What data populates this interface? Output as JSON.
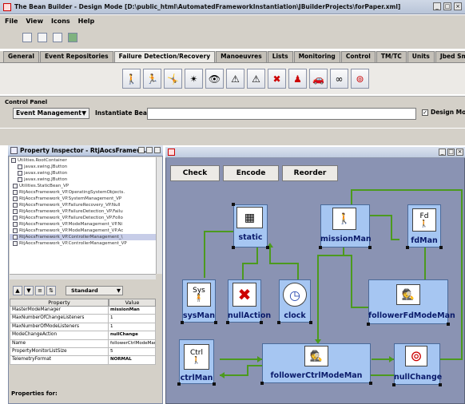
{
  "window": {
    "title": "The Bean Builder - Design Mode [D:\\public_html\\AutomatedFrameworkInstantiation\\JBuilderProjects\\forPaper.xml]"
  },
  "menu": [
    "File",
    "View",
    "Icons",
    "Help"
  ],
  "tabs": [
    {
      "label": "General",
      "active": false
    },
    {
      "label": "Event Repositories",
      "active": false
    },
    {
      "label": "Failure Detection/Recovery",
      "active": true
    },
    {
      "label": "Manoeuvres",
      "active": false
    },
    {
      "label": "Lists",
      "active": false
    },
    {
      "label": "Monitoring",
      "active": false
    },
    {
      "label": "Control",
      "active": false
    },
    {
      "label": "TM/TC",
      "active": false
    },
    {
      "label": "Units",
      "active": false
    },
    {
      "label": "Jbed Smm",
      "active": false
    }
  ],
  "palette_icons": [
    "bean-figure-icon",
    "bean-figure-run-icon",
    "bean-figure-jump-icon",
    "bean-figure-star-icon",
    "eye-icon",
    "recovery-warning-icon",
    "reset-warning-icon",
    "cross-figure-icon",
    "red-person-icon",
    "car-icon",
    "link-icon",
    "two-circles-icon"
  ],
  "control_panel": {
    "label": "Control Panel",
    "event_select": "Event Management",
    "instantiate_label": "Instantiate Bean",
    "instantiate_value": "",
    "design_mode_label": "Design Mode",
    "design_mode_checked": true
  },
  "property_inspector": {
    "title": "Property Inspector - RtjAocsFramew...",
    "tree": [
      {
        "label": "Utilities.RootContainer",
        "selected": false
      },
      {
        "label": "javax.swing.JButton",
        "selected": false
      },
      {
        "label": "javax.swing.JButton",
        "selected": false
      },
      {
        "label": "javax.swing.JButton",
        "selected": false
      },
      {
        "label": "Utilities.StaticBean_VP",
        "selected": false
      },
      {
        "label": "RtjAocsFramework_VP.OperatingSystemObjects.",
        "selected": false
      },
      {
        "label": "RtjAocsFramework_VP.SystemManagement_VP",
        "selected": false
      },
      {
        "label": "RtjAocsFramework_VP.FailureRecovery_VP.Null",
        "selected": false
      },
      {
        "label": "RtjAocsFramework_VP.FailureDetection_VP.Failu",
        "selected": false
      },
      {
        "label": "RtjAocsFramework_VP.FailureDetection_VP.Follo",
        "selected": false
      },
      {
        "label": "RtjAocsFramework_VP.ModeManagement_VP.Ni",
        "selected": false
      },
      {
        "label": "RtjAocsFramework_VP.ModeManagement_VP.Ac",
        "selected": false
      },
      {
        "label": "RtjAocsFramework_VP.ControllerManagement_\\",
        "selected": true
      },
      {
        "label": "RtjAocsFramework_VP.ControllerManagement_VP",
        "selected": false
      }
    ],
    "view_select": "Standard",
    "table_headers": [
      "Property",
      "Value"
    ],
    "properties": [
      {
        "name": "MasterModeManager",
        "value": "missionMan",
        "bold": true
      },
      {
        "name": "MaxNumberOfChangeListeners",
        "value": "1",
        "bold": false
      },
      {
        "name": "MaxNumberOfModeListeners",
        "value": "1",
        "bold": false
      },
      {
        "name": "ModeChangeAction",
        "value": "nullChange",
        "bold": true
      },
      {
        "name": "Name",
        "value": "followerCtrlModeMan",
        "bold": false
      },
      {
        "name": "PropertyMonitorListSize",
        "value": "5",
        "bold": false
      },
      {
        "name": "TelemetryFormat",
        "value": "NORMAL",
        "bold": true
      }
    ],
    "properties_for": "Properties for:"
  },
  "canvas": {
    "buttons": [
      "Check",
      "Encode",
      "Reorder"
    ],
    "beans": {
      "static": "static",
      "missionMan": "missionMan",
      "fdMan": "fdMan",
      "sysMan": "sysMan",
      "nullAction": "nullAction",
      "clock": "clock",
      "followerFdModeMan": "followerFdModeMan",
      "ctrlMan": "ctrlMan",
      "followerCtrlModeMan": "followerCtrlModeMan",
      "nullChange": "nullChange"
    },
    "icon_text": {
      "sysMan": "Sys",
      "ctrlMan": "Ctrl",
      "fdMan": "Fd"
    },
    "colors": {
      "canvas_bg": "#8a93b3",
      "bean_bg": "#a6c6f2",
      "connector": "#4c9a1e"
    }
  }
}
